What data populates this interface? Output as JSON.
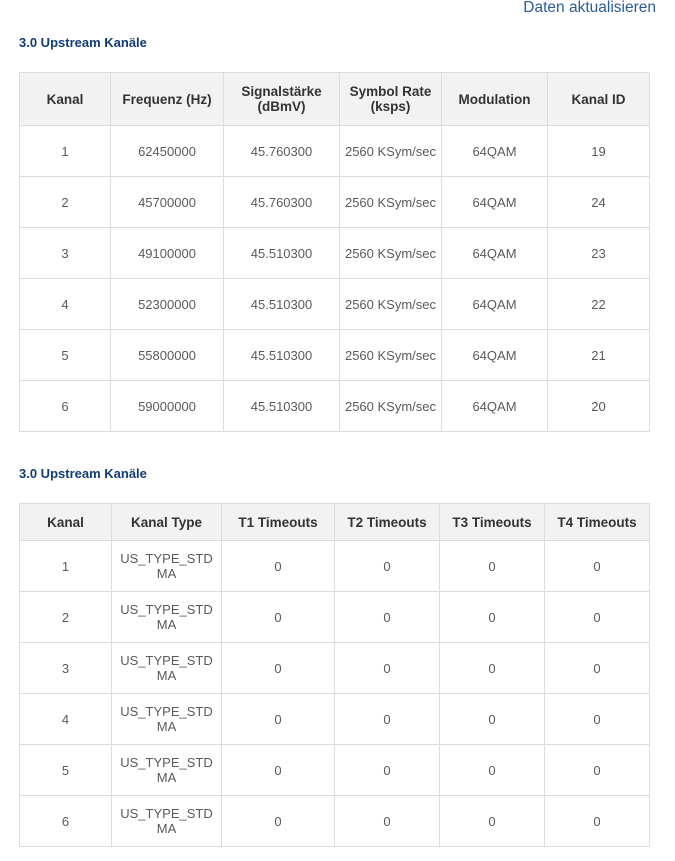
{
  "refresh_label": "Daten aktualisieren",
  "section1": {
    "title": "3.0 Upstream Kanäle",
    "headers": [
      "Kanal",
      "Frequenz (Hz)",
      "Signalstärke (dBmV)",
      "Symbol Rate (ksps)",
      "Modulation",
      "Kanal ID"
    ],
    "rows": [
      [
        "1",
        "62450000",
        "45.760300",
        "2560 KSym/sec",
        "64QAM",
        "19"
      ],
      [
        "2",
        "45700000",
        "45.760300",
        "2560 KSym/sec",
        "64QAM",
        "24"
      ],
      [
        "3",
        "49100000",
        "45.510300",
        "2560 KSym/sec",
        "64QAM",
        "23"
      ],
      [
        "4",
        "52300000",
        "45.510300",
        "2560 KSym/sec",
        "64QAM",
        "22"
      ],
      [
        "5",
        "55800000",
        "45.510300",
        "2560 KSym/sec",
        "64QAM",
        "21"
      ],
      [
        "6",
        "59000000",
        "45.510300",
        "2560 KSym/sec",
        "64QAM",
        "20"
      ]
    ]
  },
  "section2": {
    "title": "3.0 Upstream Kanäle",
    "headers": [
      "Kanal",
      "Kanal Type",
      "T1 Timeouts",
      "T2 Timeouts",
      "T3 Timeouts",
      "T4 Timeouts"
    ],
    "rows": [
      [
        "1",
        "US_TYPE_STDMA",
        "0",
        "0",
        "0",
        "0"
      ],
      [
        "2",
        "US_TYPE_STDMA",
        "0",
        "0",
        "0",
        "0"
      ],
      [
        "3",
        "US_TYPE_STDMA",
        "0",
        "0",
        "0",
        "0"
      ],
      [
        "4",
        "US_TYPE_STDMA",
        "0",
        "0",
        "0",
        "0"
      ],
      [
        "5",
        "US_TYPE_STDMA",
        "0",
        "0",
        "0",
        "0"
      ],
      [
        "6",
        "US_TYPE_STDMA",
        "0",
        "0",
        "0",
        "0"
      ]
    ]
  }
}
